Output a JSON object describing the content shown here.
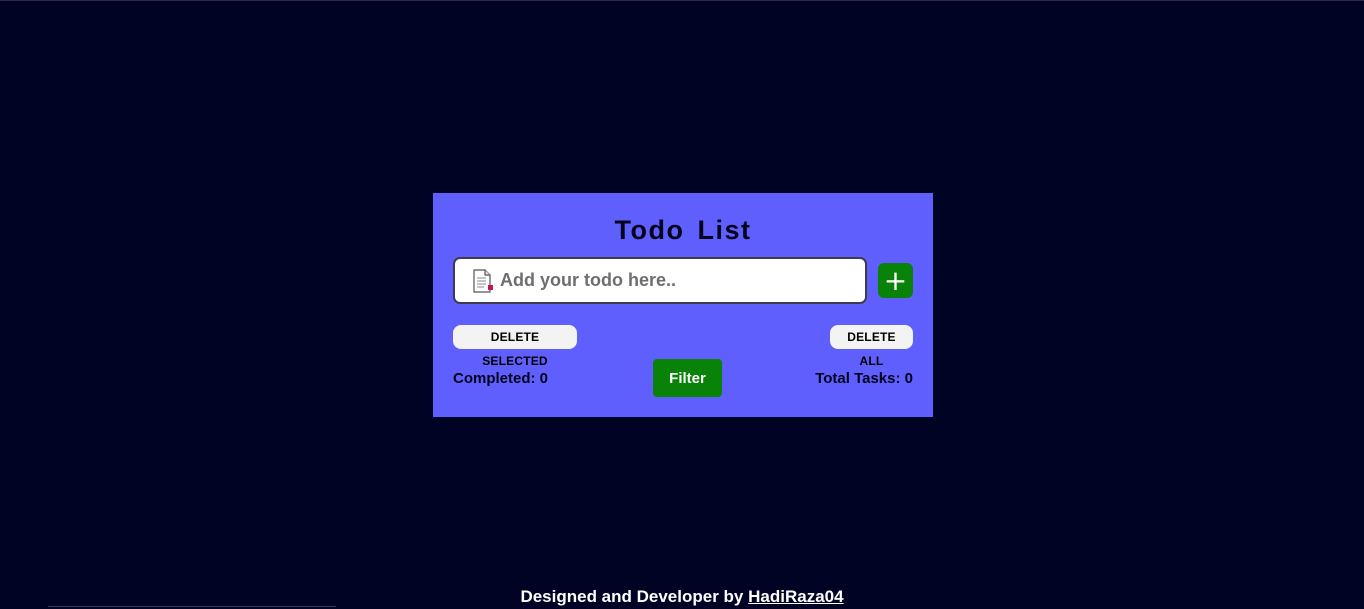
{
  "app": {
    "title": "Todo List"
  },
  "input": {
    "placeholder": "Add your todo here..",
    "value": "",
    "icon": "memo-icon"
  },
  "buttons": {
    "add_label": "+",
    "delete_selected_label": "DELETE SELECTED",
    "delete_all_label": "DELETE ALL",
    "filter_label": "Filter"
  },
  "stats": {
    "completed_label": "Completed: 0",
    "total_label": "Total Tasks: 0"
  },
  "footer": {
    "text": "Designed and Developer by",
    "author_link": "HadiRaza04"
  },
  "colors": {
    "background": "#010324",
    "card": "#5f5ffd",
    "accent_green": "#088208"
  }
}
